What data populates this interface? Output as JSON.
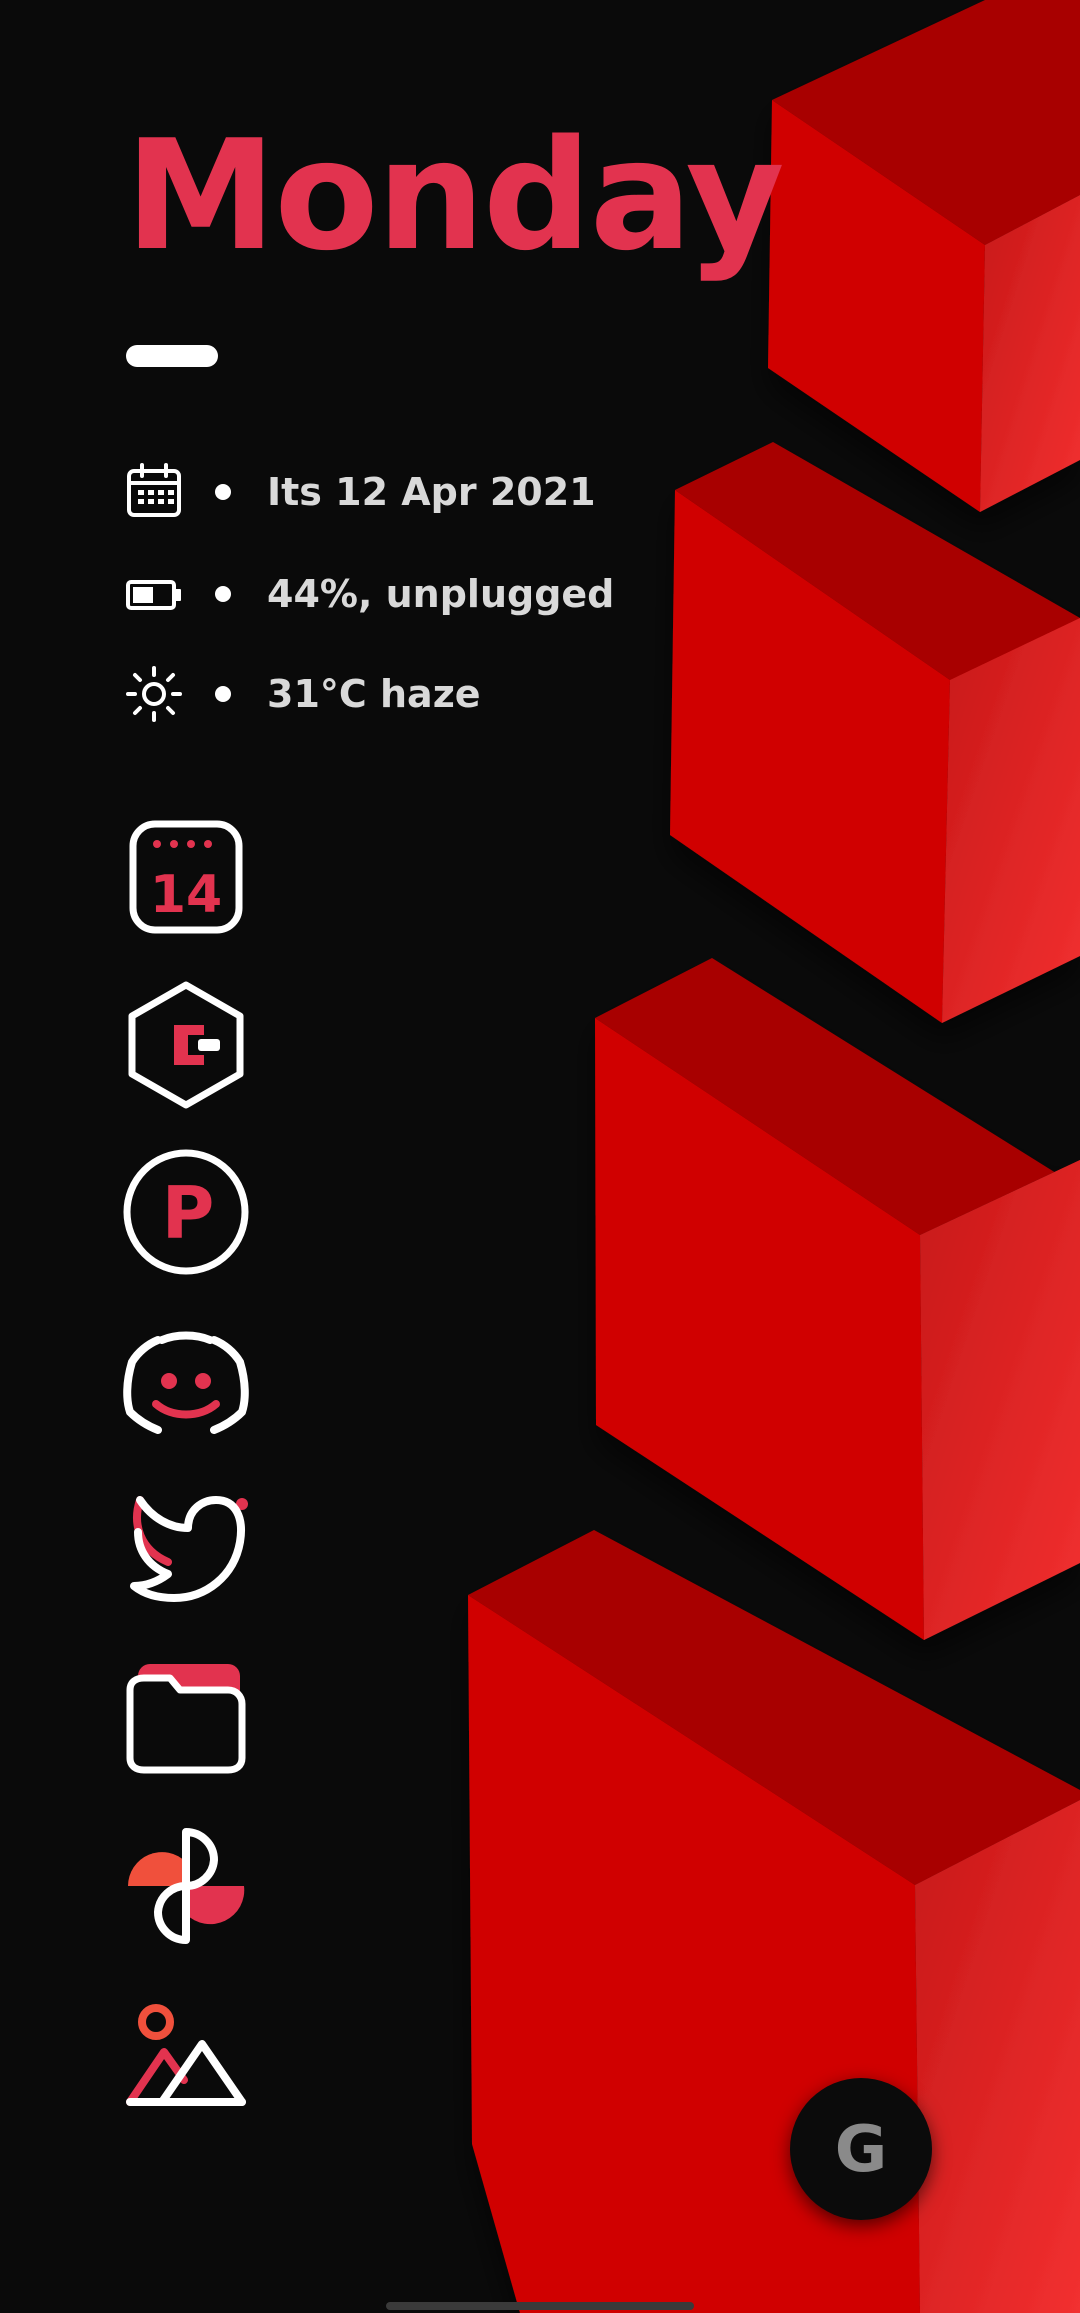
{
  "colors": {
    "accent": "#e2334f",
    "accent_orange": "#f0503c",
    "background": "#0a0a0a",
    "icon_stroke": "#ffffff",
    "info_text": "#d9d9d9"
  },
  "widget": {
    "day": "Monday",
    "info": [
      {
        "icon": "calendar-icon",
        "text": "Its 12 Apr 2021"
      },
      {
        "icon": "battery-icon",
        "text": "44%, unplugged"
      },
      {
        "icon": "sun-icon",
        "text": "31°C haze"
      }
    ]
  },
  "apps": [
    {
      "icon": "calendar-app-icon",
      "label": "14"
    },
    {
      "icon": "hexagon-app-icon"
    },
    {
      "icon": "p-circle-app-icon",
      "label": "P"
    },
    {
      "icon": "discord-icon"
    },
    {
      "icon": "twitter-icon"
    },
    {
      "icon": "folder-icon"
    },
    {
      "icon": "pinwheel-icon"
    },
    {
      "icon": "gallery-icon"
    }
  ],
  "fab": {
    "icon": "google-icon",
    "label": "G"
  }
}
